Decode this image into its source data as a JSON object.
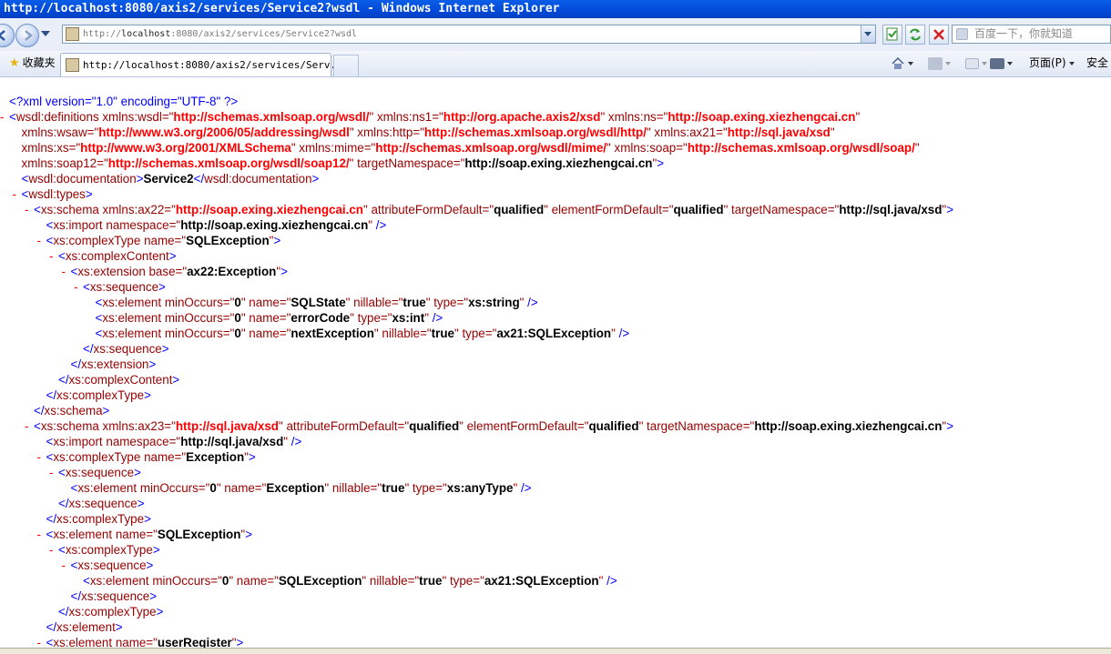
{
  "window": {
    "title": "http://localhost:8080/axis2/services/Service2?wsdl - Windows Internet Explorer"
  },
  "address_bar": {
    "url_prefix": "http://",
    "url_host": "localhost",
    "url_rest": ":8080/axis2/services/Service2?wsdl"
  },
  "search": {
    "placeholder": "百度一下，你就知道"
  },
  "tabs": {
    "favorites_label": "收藏夹",
    "active_tab": "http://localhost:8080/axis2/services/Serv..."
  },
  "command_bar": {
    "page_label": "页面(P)",
    "safety_label": "安全"
  },
  "xml_lines": [
    {
      "ind": 0,
      "mk": "",
      "parts": [
        [
          "pu",
          "<?xml version=\"1.0\" encoding=\"UTF-8\" ?>"
        ]
      ]
    },
    {
      "ind": 0,
      "mk": "-",
      "parts": [
        [
          "pu",
          "<"
        ],
        [
          "tg",
          "wsdl:definitions "
        ],
        [
          "an",
          "xmlns:wsdl=\""
        ],
        [
          "av",
          "http://schemas.xmlsoap.org/wsdl/"
        ],
        [
          "an",
          "\" xmlns:ns1=\""
        ],
        [
          "av",
          "http://org.apache.axis2/xsd"
        ],
        [
          "an",
          "\" xmlns:ns=\""
        ],
        [
          "av",
          "http://soap.exing.xiezhengcai.cn"
        ],
        [
          "an",
          "\""
        ]
      ]
    },
    {
      "ind": 1,
      "mk": "",
      "parts": [
        [
          "an",
          "xmlns:wsaw=\""
        ],
        [
          "av",
          "http://www.w3.org/2006/05/addressing/wsdl"
        ],
        [
          "an",
          "\" xmlns:http=\""
        ],
        [
          "av",
          "http://schemas.xmlsoap.org/wsdl/http/"
        ],
        [
          "an",
          "\" xmlns:ax21=\""
        ],
        [
          "av",
          "http://sql.java/xsd"
        ],
        [
          "an",
          "\""
        ]
      ]
    },
    {
      "ind": 1,
      "mk": "",
      "parts": [
        [
          "an",
          "xmlns:xs=\""
        ],
        [
          "av",
          "http://www.w3.org/2001/XMLSchema"
        ],
        [
          "an",
          "\" xmlns:mime=\""
        ],
        [
          "av",
          "http://schemas.xmlsoap.org/wsdl/mime/"
        ],
        [
          "an",
          "\" xmlns:soap=\""
        ],
        [
          "av",
          "http://schemas.xmlsoap.org/wsdl/soap/"
        ],
        [
          "an",
          "\""
        ]
      ]
    },
    {
      "ind": 1,
      "mk": "",
      "parts": [
        [
          "an",
          "xmlns:soap12=\""
        ],
        [
          "av",
          "http://schemas.xmlsoap.org/wsdl/soap12/"
        ],
        [
          "an",
          "\" targetNamespace=\""
        ],
        [
          "tx",
          "http://soap.exing.xiezhengcai.cn"
        ],
        [
          "an",
          "\""
        ],
        [
          "pu",
          ">"
        ]
      ]
    },
    {
      "ind": 1,
      "mk": "",
      "parts": [
        [
          "pu",
          "<"
        ],
        [
          "tg",
          "wsdl:documentation"
        ],
        [
          "pu",
          ">"
        ],
        [
          "tx",
          "Service2"
        ],
        [
          "pu",
          "</"
        ],
        [
          "tg",
          "wsdl:documentation"
        ],
        [
          "pu",
          ">"
        ]
      ]
    },
    {
      "ind": 1,
      "mk": "-",
      "parts": [
        [
          "pu",
          "<"
        ],
        [
          "tg",
          "wsdl:types"
        ],
        [
          "pu",
          ">"
        ]
      ]
    },
    {
      "ind": 2,
      "mk": "-",
      "parts": [
        [
          "pu",
          "<"
        ],
        [
          "tg",
          "xs:schema "
        ],
        [
          "an",
          "xmlns:ax22=\""
        ],
        [
          "av",
          "http://soap.exing.xiezhengcai.cn"
        ],
        [
          "an",
          "\" attributeFormDefault=\""
        ],
        [
          "tx",
          "qualified"
        ],
        [
          "an",
          "\" elementFormDefault=\""
        ],
        [
          "tx",
          "qualified"
        ],
        [
          "an",
          "\" targetNamespace=\""
        ],
        [
          "tx",
          "http://sql.java/xsd"
        ],
        [
          "an",
          "\""
        ],
        [
          "pu",
          ">"
        ]
      ]
    },
    {
      "ind": 3,
      "mk": "",
      "parts": [
        [
          "pu",
          "<"
        ],
        [
          "tg",
          "xs:import "
        ],
        [
          "an",
          "namespace=\""
        ],
        [
          "tx",
          "http://soap.exing.xiezhengcai.cn"
        ],
        [
          "an",
          "\""
        ],
        [
          "pu",
          " />"
        ]
      ]
    },
    {
      "ind": 3,
      "mk": "-",
      "parts": [
        [
          "pu",
          "<"
        ],
        [
          "tg",
          "xs:complexType "
        ],
        [
          "an",
          "name=\""
        ],
        [
          "tx",
          "SQLException"
        ],
        [
          "an",
          "\""
        ],
        [
          "pu",
          ">"
        ]
      ]
    },
    {
      "ind": 4,
      "mk": "-",
      "parts": [
        [
          "pu",
          "<"
        ],
        [
          "tg",
          "xs:complexContent"
        ],
        [
          "pu",
          ">"
        ]
      ]
    },
    {
      "ind": 5,
      "mk": "-",
      "parts": [
        [
          "pu",
          "<"
        ],
        [
          "tg",
          "xs:extension "
        ],
        [
          "an",
          "base=\""
        ],
        [
          "tx",
          "ax22:Exception"
        ],
        [
          "an",
          "\""
        ],
        [
          "pu",
          ">"
        ]
      ]
    },
    {
      "ind": 6,
      "mk": "-",
      "parts": [
        [
          "pu",
          "<"
        ],
        [
          "tg",
          "xs:sequence"
        ],
        [
          "pu",
          ">"
        ]
      ]
    },
    {
      "ind": 7,
      "mk": "",
      "parts": [
        [
          "pu",
          "<"
        ],
        [
          "tg",
          "xs:element "
        ],
        [
          "an",
          "minOccurs=\""
        ],
        [
          "tx",
          "0"
        ],
        [
          "an",
          "\" name=\""
        ],
        [
          "tx",
          "SQLState"
        ],
        [
          "an",
          "\" nillable=\""
        ],
        [
          "tx",
          "true"
        ],
        [
          "an",
          "\" type=\""
        ],
        [
          "tx",
          "xs:string"
        ],
        [
          "an",
          "\""
        ],
        [
          "pu",
          " />"
        ]
      ]
    },
    {
      "ind": 7,
      "mk": "",
      "parts": [
        [
          "pu",
          "<"
        ],
        [
          "tg",
          "xs:element "
        ],
        [
          "an",
          "minOccurs=\""
        ],
        [
          "tx",
          "0"
        ],
        [
          "an",
          "\" name=\""
        ],
        [
          "tx",
          "errorCode"
        ],
        [
          "an",
          "\" type=\""
        ],
        [
          "tx",
          "xs:int"
        ],
        [
          "an",
          "\""
        ],
        [
          "pu",
          " />"
        ]
      ]
    },
    {
      "ind": 7,
      "mk": "",
      "parts": [
        [
          "pu",
          "<"
        ],
        [
          "tg",
          "xs:element "
        ],
        [
          "an",
          "minOccurs=\""
        ],
        [
          "tx",
          "0"
        ],
        [
          "an",
          "\" name=\""
        ],
        [
          "tx",
          "nextException"
        ],
        [
          "an",
          "\" nillable=\""
        ],
        [
          "tx",
          "true"
        ],
        [
          "an",
          "\" type=\""
        ],
        [
          "tx",
          "ax21:SQLException"
        ],
        [
          "an",
          "\""
        ],
        [
          "pu",
          " />"
        ]
      ]
    },
    {
      "ind": 6,
      "mk": "",
      "parts": [
        [
          "pu",
          "</"
        ],
        [
          "tg",
          "xs:sequence"
        ],
        [
          "pu",
          ">"
        ]
      ]
    },
    {
      "ind": 5,
      "mk": "",
      "parts": [
        [
          "pu",
          "</"
        ],
        [
          "tg",
          "xs:extension"
        ],
        [
          "pu",
          ">"
        ]
      ]
    },
    {
      "ind": 4,
      "mk": "",
      "parts": [
        [
          "pu",
          "</"
        ],
        [
          "tg",
          "xs:complexContent"
        ],
        [
          "pu",
          ">"
        ]
      ]
    },
    {
      "ind": 3,
      "mk": "",
      "parts": [
        [
          "pu",
          "</"
        ],
        [
          "tg",
          "xs:complexType"
        ],
        [
          "pu",
          ">"
        ]
      ]
    },
    {
      "ind": 2,
      "mk": "",
      "parts": [
        [
          "pu",
          "</"
        ],
        [
          "tg",
          "xs:schema"
        ],
        [
          "pu",
          ">"
        ]
      ]
    },
    {
      "ind": 2,
      "mk": "-",
      "parts": [
        [
          "pu",
          "<"
        ],
        [
          "tg",
          "xs:schema "
        ],
        [
          "an",
          "xmlns:ax23=\""
        ],
        [
          "av",
          "http://sql.java/xsd"
        ],
        [
          "an",
          "\" attributeFormDefault=\""
        ],
        [
          "tx",
          "qualified"
        ],
        [
          "an",
          "\" elementFormDefault=\""
        ],
        [
          "tx",
          "qualified"
        ],
        [
          "an",
          "\" targetNamespace=\""
        ],
        [
          "tx",
          "http://soap.exing.xiezhengcai.cn"
        ],
        [
          "an",
          "\""
        ],
        [
          "pu",
          ">"
        ]
      ]
    },
    {
      "ind": 3,
      "mk": "",
      "parts": [
        [
          "pu",
          "<"
        ],
        [
          "tg",
          "xs:import "
        ],
        [
          "an",
          "namespace=\""
        ],
        [
          "tx",
          "http://sql.java/xsd"
        ],
        [
          "an",
          "\""
        ],
        [
          "pu",
          " />"
        ]
      ]
    },
    {
      "ind": 3,
      "mk": "-",
      "parts": [
        [
          "pu",
          "<"
        ],
        [
          "tg",
          "xs:complexType "
        ],
        [
          "an",
          "name=\""
        ],
        [
          "tx",
          "Exception"
        ],
        [
          "an",
          "\""
        ],
        [
          "pu",
          ">"
        ]
      ]
    },
    {
      "ind": 4,
      "mk": "-",
      "parts": [
        [
          "pu",
          "<"
        ],
        [
          "tg",
          "xs:sequence"
        ],
        [
          "pu",
          ">"
        ]
      ]
    },
    {
      "ind": 5,
      "mk": "",
      "parts": [
        [
          "pu",
          "<"
        ],
        [
          "tg",
          "xs:element "
        ],
        [
          "an",
          "minOccurs=\""
        ],
        [
          "tx",
          "0"
        ],
        [
          "an",
          "\" name=\""
        ],
        [
          "tx",
          "Exception"
        ],
        [
          "an",
          "\" nillable=\""
        ],
        [
          "tx",
          "true"
        ],
        [
          "an",
          "\" type=\""
        ],
        [
          "tx",
          "xs:anyType"
        ],
        [
          "an",
          "\""
        ],
        [
          "pu",
          " />"
        ]
      ]
    },
    {
      "ind": 4,
      "mk": "",
      "parts": [
        [
          "pu",
          "</"
        ],
        [
          "tg",
          "xs:sequence"
        ],
        [
          "pu",
          ">"
        ]
      ]
    },
    {
      "ind": 3,
      "mk": "",
      "parts": [
        [
          "pu",
          "</"
        ],
        [
          "tg",
          "xs:complexType"
        ],
        [
          "pu",
          ">"
        ]
      ]
    },
    {
      "ind": 3,
      "mk": "-",
      "parts": [
        [
          "pu",
          "<"
        ],
        [
          "tg",
          "xs:element "
        ],
        [
          "an",
          "name=\""
        ],
        [
          "tx",
          "SQLException"
        ],
        [
          "an",
          "\""
        ],
        [
          "pu",
          ">"
        ]
      ]
    },
    {
      "ind": 4,
      "mk": "-",
      "parts": [
        [
          "pu",
          "<"
        ],
        [
          "tg",
          "xs:complexType"
        ],
        [
          "pu",
          ">"
        ]
      ]
    },
    {
      "ind": 5,
      "mk": "-",
      "parts": [
        [
          "pu",
          "<"
        ],
        [
          "tg",
          "xs:sequence"
        ],
        [
          "pu",
          ">"
        ]
      ]
    },
    {
      "ind": 6,
      "mk": "",
      "parts": [
        [
          "pu",
          "<"
        ],
        [
          "tg",
          "xs:element "
        ],
        [
          "an",
          "minOccurs=\""
        ],
        [
          "tx",
          "0"
        ],
        [
          "an",
          "\" name=\""
        ],
        [
          "tx",
          "SQLException"
        ],
        [
          "an",
          "\" nillable=\""
        ],
        [
          "tx",
          "true"
        ],
        [
          "an",
          "\" type=\""
        ],
        [
          "tx",
          "ax21:SQLException"
        ],
        [
          "an",
          "\""
        ],
        [
          "pu",
          " />"
        ]
      ]
    },
    {
      "ind": 5,
      "mk": "",
      "parts": [
        [
          "pu",
          "</"
        ],
        [
          "tg",
          "xs:sequence"
        ],
        [
          "pu",
          ">"
        ]
      ]
    },
    {
      "ind": 4,
      "mk": "",
      "parts": [
        [
          "pu",
          "</"
        ],
        [
          "tg",
          "xs:complexType"
        ],
        [
          "pu",
          ">"
        ]
      ]
    },
    {
      "ind": 3,
      "mk": "",
      "parts": [
        [
          "pu",
          "</"
        ],
        [
          "tg",
          "xs:element"
        ],
        [
          "pu",
          ">"
        ]
      ]
    },
    {
      "ind": 3,
      "mk": "-",
      "parts": [
        [
          "pu",
          "<"
        ],
        [
          "tg",
          "xs:element "
        ],
        [
          "an",
          "name=\""
        ],
        [
          "tx",
          "userRegister"
        ],
        [
          "an",
          "\""
        ],
        [
          "pu",
          ">"
        ]
      ]
    }
  ]
}
